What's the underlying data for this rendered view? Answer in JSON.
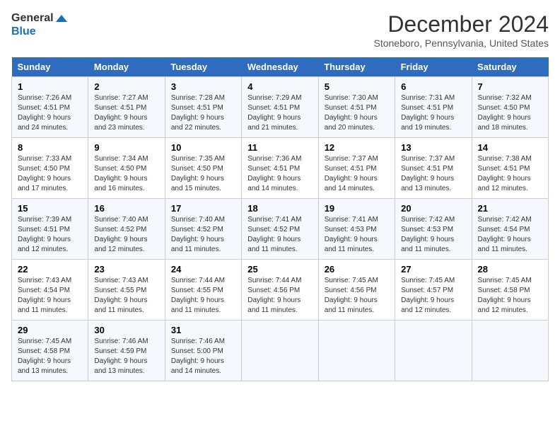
{
  "logo": {
    "line1": "General",
    "line2": "Blue"
  },
  "title": "December 2024",
  "subtitle": "Stoneboro, Pennsylvania, United States",
  "headers": [
    "Sunday",
    "Monday",
    "Tuesday",
    "Wednesday",
    "Thursday",
    "Friday",
    "Saturday"
  ],
  "weeks": [
    [
      {
        "day": "1",
        "sunrise": "Sunrise: 7:26 AM",
        "sunset": "Sunset: 4:51 PM",
        "daylight": "Daylight: 9 hours and 24 minutes."
      },
      {
        "day": "2",
        "sunrise": "Sunrise: 7:27 AM",
        "sunset": "Sunset: 4:51 PM",
        "daylight": "Daylight: 9 hours and 23 minutes."
      },
      {
        "day": "3",
        "sunrise": "Sunrise: 7:28 AM",
        "sunset": "Sunset: 4:51 PM",
        "daylight": "Daylight: 9 hours and 22 minutes."
      },
      {
        "day": "4",
        "sunrise": "Sunrise: 7:29 AM",
        "sunset": "Sunset: 4:51 PM",
        "daylight": "Daylight: 9 hours and 21 minutes."
      },
      {
        "day": "5",
        "sunrise": "Sunrise: 7:30 AM",
        "sunset": "Sunset: 4:51 PM",
        "daylight": "Daylight: 9 hours and 20 minutes."
      },
      {
        "day": "6",
        "sunrise": "Sunrise: 7:31 AM",
        "sunset": "Sunset: 4:51 PM",
        "daylight": "Daylight: 9 hours and 19 minutes."
      },
      {
        "day": "7",
        "sunrise": "Sunrise: 7:32 AM",
        "sunset": "Sunset: 4:50 PM",
        "daylight": "Daylight: 9 hours and 18 minutes."
      }
    ],
    [
      {
        "day": "8",
        "sunrise": "Sunrise: 7:33 AM",
        "sunset": "Sunset: 4:50 PM",
        "daylight": "Daylight: 9 hours and 17 minutes."
      },
      {
        "day": "9",
        "sunrise": "Sunrise: 7:34 AM",
        "sunset": "Sunset: 4:50 PM",
        "daylight": "Daylight: 9 hours and 16 minutes."
      },
      {
        "day": "10",
        "sunrise": "Sunrise: 7:35 AM",
        "sunset": "Sunset: 4:50 PM",
        "daylight": "Daylight: 9 hours and 15 minutes."
      },
      {
        "day": "11",
        "sunrise": "Sunrise: 7:36 AM",
        "sunset": "Sunset: 4:51 PM",
        "daylight": "Daylight: 9 hours and 14 minutes."
      },
      {
        "day": "12",
        "sunrise": "Sunrise: 7:37 AM",
        "sunset": "Sunset: 4:51 PM",
        "daylight": "Daylight: 9 hours and 14 minutes."
      },
      {
        "day": "13",
        "sunrise": "Sunrise: 7:37 AM",
        "sunset": "Sunset: 4:51 PM",
        "daylight": "Daylight: 9 hours and 13 minutes."
      },
      {
        "day": "14",
        "sunrise": "Sunrise: 7:38 AM",
        "sunset": "Sunset: 4:51 PM",
        "daylight": "Daylight: 9 hours and 12 minutes."
      }
    ],
    [
      {
        "day": "15",
        "sunrise": "Sunrise: 7:39 AM",
        "sunset": "Sunset: 4:51 PM",
        "daylight": "Daylight: 9 hours and 12 minutes."
      },
      {
        "day": "16",
        "sunrise": "Sunrise: 7:40 AM",
        "sunset": "Sunset: 4:52 PM",
        "daylight": "Daylight: 9 hours and 12 minutes."
      },
      {
        "day": "17",
        "sunrise": "Sunrise: 7:40 AM",
        "sunset": "Sunset: 4:52 PM",
        "daylight": "Daylight: 9 hours and 11 minutes."
      },
      {
        "day": "18",
        "sunrise": "Sunrise: 7:41 AM",
        "sunset": "Sunset: 4:52 PM",
        "daylight": "Daylight: 9 hours and 11 minutes."
      },
      {
        "day": "19",
        "sunrise": "Sunrise: 7:41 AM",
        "sunset": "Sunset: 4:53 PM",
        "daylight": "Daylight: 9 hours and 11 minutes."
      },
      {
        "day": "20",
        "sunrise": "Sunrise: 7:42 AM",
        "sunset": "Sunset: 4:53 PM",
        "daylight": "Daylight: 9 hours and 11 minutes."
      },
      {
        "day": "21",
        "sunrise": "Sunrise: 7:42 AM",
        "sunset": "Sunset: 4:54 PM",
        "daylight": "Daylight: 9 hours and 11 minutes."
      }
    ],
    [
      {
        "day": "22",
        "sunrise": "Sunrise: 7:43 AM",
        "sunset": "Sunset: 4:54 PM",
        "daylight": "Daylight: 9 hours and 11 minutes."
      },
      {
        "day": "23",
        "sunrise": "Sunrise: 7:43 AM",
        "sunset": "Sunset: 4:55 PM",
        "daylight": "Daylight: 9 hours and 11 minutes."
      },
      {
        "day": "24",
        "sunrise": "Sunrise: 7:44 AM",
        "sunset": "Sunset: 4:55 PM",
        "daylight": "Daylight: 9 hours and 11 minutes."
      },
      {
        "day": "25",
        "sunrise": "Sunrise: 7:44 AM",
        "sunset": "Sunset: 4:56 PM",
        "daylight": "Daylight: 9 hours and 11 minutes."
      },
      {
        "day": "26",
        "sunrise": "Sunrise: 7:45 AM",
        "sunset": "Sunset: 4:56 PM",
        "daylight": "Daylight: 9 hours and 11 minutes."
      },
      {
        "day": "27",
        "sunrise": "Sunrise: 7:45 AM",
        "sunset": "Sunset: 4:57 PM",
        "daylight": "Daylight: 9 hours and 12 minutes."
      },
      {
        "day": "28",
        "sunrise": "Sunrise: 7:45 AM",
        "sunset": "Sunset: 4:58 PM",
        "daylight": "Daylight: 9 hours and 12 minutes."
      }
    ],
    [
      {
        "day": "29",
        "sunrise": "Sunrise: 7:45 AM",
        "sunset": "Sunset: 4:58 PM",
        "daylight": "Daylight: 9 hours and 13 minutes."
      },
      {
        "day": "30",
        "sunrise": "Sunrise: 7:46 AM",
        "sunset": "Sunset: 4:59 PM",
        "daylight": "Daylight: 9 hours and 13 minutes."
      },
      {
        "day": "31",
        "sunrise": "Sunrise: 7:46 AM",
        "sunset": "Sunset: 5:00 PM",
        "daylight": "Daylight: 9 hours and 14 minutes."
      },
      null,
      null,
      null,
      null
    ]
  ]
}
